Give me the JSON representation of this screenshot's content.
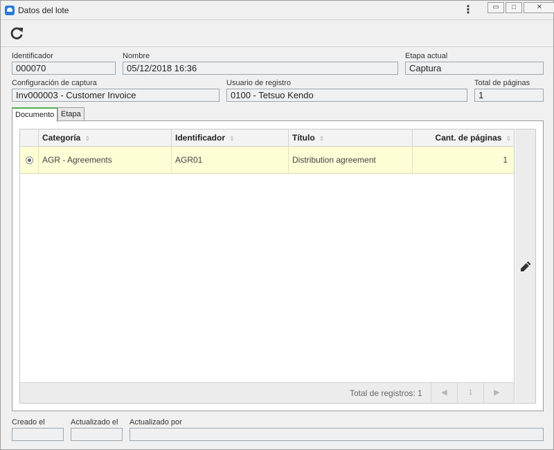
{
  "window": {
    "title": "Datos del lote",
    "menu_icon": "kebab-menu-icon",
    "controls": {
      "minimize": "▭",
      "restore": "□",
      "close": "✕"
    }
  },
  "toolbar": {
    "refresh_icon": "refresh-icon"
  },
  "fields": {
    "identificador": {
      "label": "Identificador",
      "value": "000070"
    },
    "nombre": {
      "label": "Nombre",
      "value": "05/12/2018 16:36"
    },
    "etapa_actual": {
      "label": "Etapa actual",
      "value": "Captura"
    },
    "configuracion": {
      "label": "Configuración de captura",
      "value": "Inv000003 - Customer Invoice"
    },
    "usuario": {
      "label": "Usuario de registro",
      "value": "0100 - Tetsuo Kendo"
    },
    "total_paginas": {
      "label": "Total de páginas",
      "value": "1"
    }
  },
  "tabs": [
    {
      "label": "Documento",
      "active": true
    },
    {
      "label": "Etapa",
      "active": false
    }
  ],
  "grid": {
    "columns": [
      "Categoría",
      "Identificador",
      "Título",
      "Cant. de páginas"
    ],
    "sort_icon": "⇕",
    "rows": [
      {
        "categoria": "AGR - Agreements",
        "identificador": "AGR01",
        "titulo": "Distribution agreement",
        "paginas": "1"
      }
    ],
    "total_label": "Total de registros: 1",
    "pager": {
      "prev": "◀",
      "page": "1",
      "next": "▶"
    }
  },
  "side_actions": {
    "edit_icon": "pencil-icon"
  },
  "footer": {
    "creado_el": {
      "label": "Creado el",
      "value": ""
    },
    "actualizado_el": {
      "label": "Actualizado el",
      "value": ""
    },
    "actualizado_por": {
      "label": "Actualizado por",
      "value": ""
    }
  },
  "colors": {
    "accent_tab": "#4caf50",
    "selected_row": "#fdfdd6",
    "field_border": "#9ba6b1"
  }
}
